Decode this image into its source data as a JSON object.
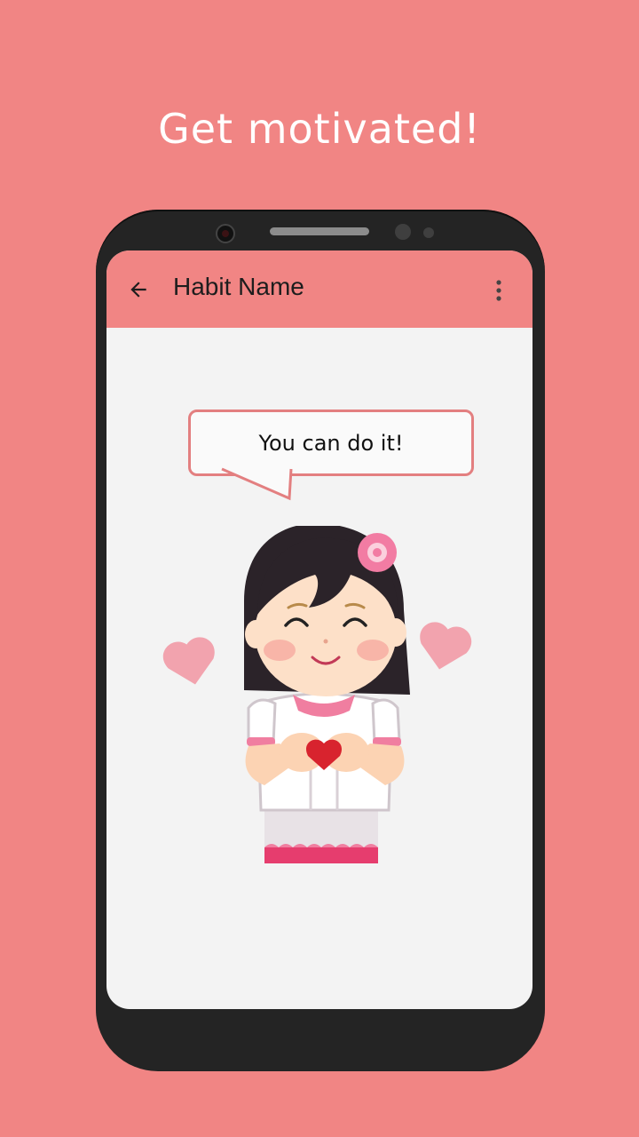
{
  "headline": "Get motivated!",
  "appbar": {
    "title": "Habit Name",
    "back_icon": "arrow-back-icon",
    "menu_icon": "more-vert-icon"
  },
  "bubble": {
    "text": "You can do it!"
  },
  "illustration": {
    "subject": "girl-making-heart-with-hands"
  },
  "colors": {
    "background": "#f18584",
    "appbar": "#f18584",
    "screen": "#f3f3f3",
    "phone_frame": "#242424",
    "bubble_border": "#e37f80"
  }
}
